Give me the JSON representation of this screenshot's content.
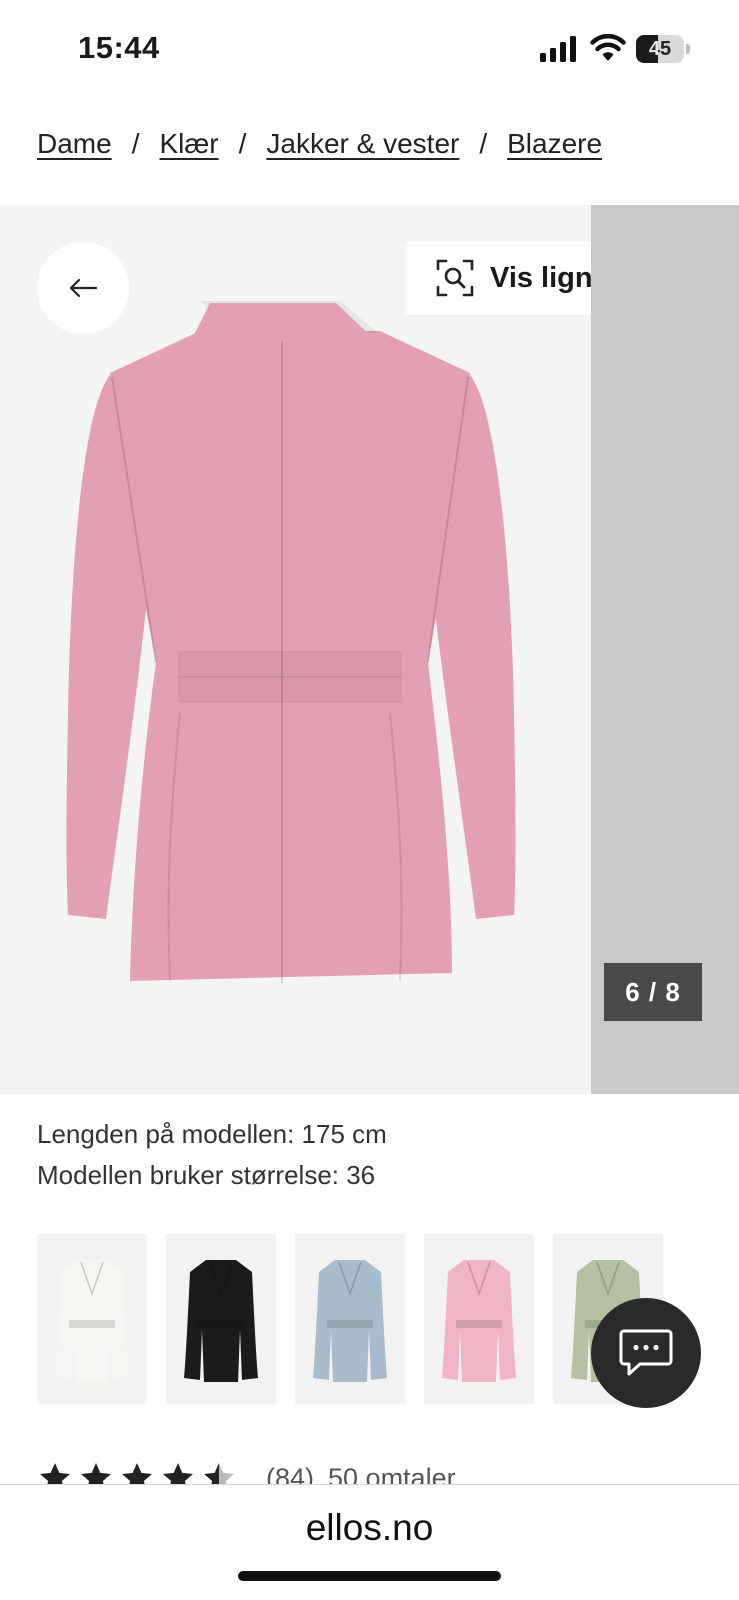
{
  "status_bar": {
    "time": "15:44",
    "battery_level": "45"
  },
  "breadcrumb": {
    "items": [
      "Dame",
      "Klær",
      "Jakker & vester",
      "Blazere"
    ],
    "separator": "/"
  },
  "gallery": {
    "similar_label": "Vis lignende",
    "counter": "6 / 8",
    "product_color": "#e3a0b2",
    "next_image_bg": "#c9c9c7"
  },
  "model_info": {
    "height_line": "Lengden på modellen: 175 cm",
    "size_line": "Modellen bruker størrelse: 36"
  },
  "swatches": [
    {
      "name": "white",
      "color": "#f7f5f1"
    },
    {
      "name": "black",
      "color": "#1b1b1b"
    },
    {
      "name": "light-blue",
      "color": "#a9bccb"
    },
    {
      "name": "pink",
      "color": "#f0b5c4"
    },
    {
      "name": "sage",
      "color": "#b4c09f"
    }
  ],
  "rating": {
    "stars": 4.5,
    "count": "(84)",
    "reviews": "50 omtaler"
  },
  "browser": {
    "url": "ellos.no"
  },
  "icons": {
    "back": "arrow-left-icon",
    "similar": "visual-search-icon",
    "chat": "chat-bubble-icon"
  }
}
